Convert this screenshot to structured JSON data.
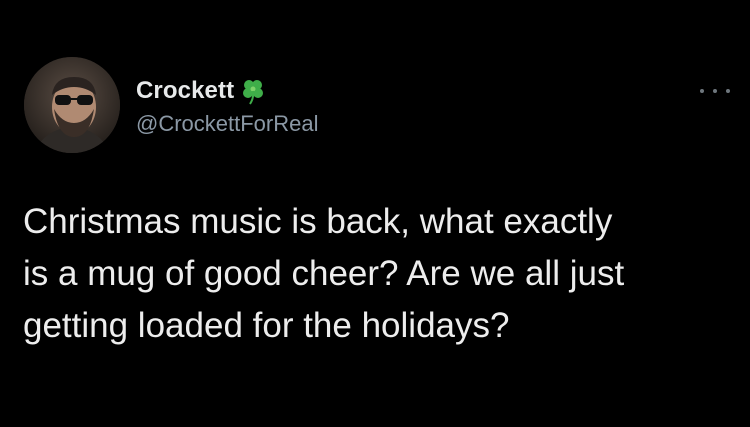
{
  "author": {
    "display_name": "Crockett",
    "handle": "@CrockettForReal",
    "badge_icon": "four-leaf-clover-icon",
    "badge_color": "#3fae49"
  },
  "tweet": {
    "text": "Christmas music is back, what exactly\nis a mug of good cheer? Are we all just\ngetting loaded for the holidays?"
  },
  "actions": {
    "more_icon": "more-options-icon"
  },
  "theme": {
    "background": "#000000",
    "text": "#e7e9ea",
    "secondary_text": "#8b98a5"
  }
}
